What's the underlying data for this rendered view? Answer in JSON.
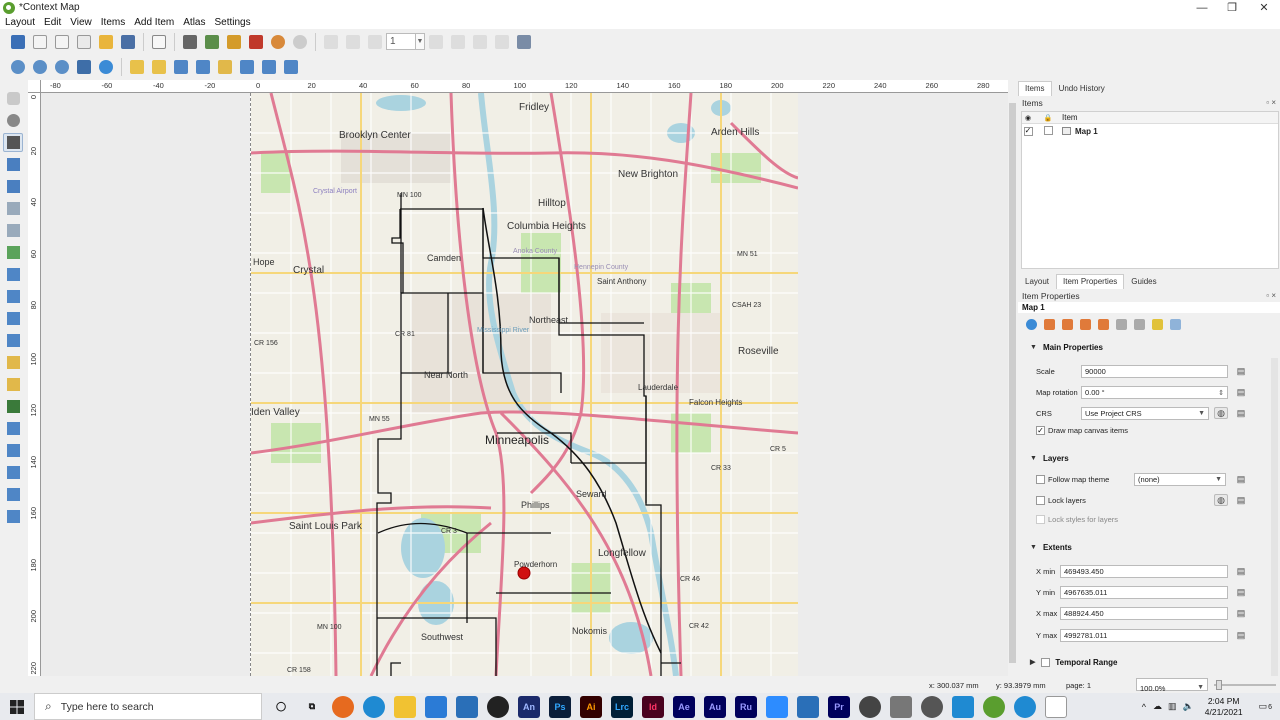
{
  "window": {
    "title": "*Context Map",
    "minimize": "—",
    "maximize": "❐",
    "close": "✕"
  },
  "menu": [
    "Layout",
    "Edit",
    "View",
    "Items",
    "Add Item",
    "Atlas",
    "Settings"
  ],
  "toolbar": {
    "page_number": "1"
  },
  "ruler": {
    "h_ticks": [
      "-80",
      "-60",
      "-40",
      "-20",
      "0",
      "20",
      "40",
      "60",
      "80",
      "100",
      "120",
      "140",
      "160",
      "180",
      "200",
      "220",
      "240",
      "260",
      "280"
    ],
    "v_ticks": [
      "0",
      "20",
      "40",
      "60",
      "80",
      "100",
      "120",
      "140",
      "160",
      "180",
      "200",
      "220"
    ]
  },
  "map": {
    "places": [
      "Fridley",
      "Brooklyn Center",
      "Arden Hills",
      "Crystal Airport",
      "MN 100",
      "New Brighton",
      "Hilltop",
      "Columbia Heights",
      "Anoka County",
      "Hennepin County",
      "Hope",
      "Crystal",
      "Camden",
      "Saint Anthony",
      "MN 51",
      "CSAH 23",
      "Northeast",
      "Mississippi River",
      "CR 81",
      "Roseville",
      "CR 156",
      "Near North",
      "Lauderdale",
      "Falcon Heights",
      "Iden Valley",
      "MN 55",
      "Minneapolis",
      "CR 5",
      "CR 33",
      "Seward",
      "Phillips",
      "Saint Louis Park",
      "CR 3",
      "Longfellow",
      "Powderhorn",
      "CR 46",
      "MN 100",
      "CR 42",
      "Nokomis",
      "Southwest",
      "CR 158"
    ]
  },
  "items_panel": {
    "tabs": [
      "Items",
      "Undo History"
    ],
    "header": "Items",
    "columns": {
      "item": "Item"
    },
    "rows": [
      {
        "name": "Map 1",
        "visible": true,
        "locked": false
      }
    ]
  },
  "props_panel": {
    "tabs": [
      "Layout",
      "Item Properties",
      "Guides"
    ],
    "header": "Item Properties",
    "item_name": "Map 1",
    "main_properties": {
      "title": "Main Properties",
      "scale_label": "Scale",
      "scale_value": "90000",
      "rotation_label": "Map rotation",
      "rotation_value": "0.00 °",
      "crs_label": "CRS",
      "crs_value": "Use Project CRS",
      "draw_canvas_label": "Draw map canvas items",
      "draw_canvas_checked": true
    },
    "layers": {
      "title": "Layers",
      "follow_theme_label": "Follow map theme",
      "theme_value": "(none)",
      "lock_layers_label": "Lock layers",
      "lock_styles_label": "Lock styles for layers"
    },
    "extents": {
      "title": "Extents",
      "xmin_label": "X min",
      "xmin_value": "469493.450",
      "ymin_label": "Y min",
      "ymin_value": "4967635.011",
      "xmax_label": "X max",
      "xmax_value": "488924.450",
      "ymax_label": "Y max",
      "ymax_value": "4992781.011"
    },
    "temporal": {
      "title": "Temporal Range"
    }
  },
  "status": {
    "x": "x: 300.037 mm",
    "y": "y: 93.3979 mm",
    "page": "page: 1",
    "zoom": "100.0%"
  },
  "taskbar": {
    "search_placeholder": "Type here to search",
    "apps": [
      "An",
      "Ps",
      "Ai",
      "Lrc",
      "Id",
      "Ae",
      "Au",
      "Ru",
      "Pr"
    ],
    "time": "2:04 PM",
    "date": "4/21/2021",
    "notification_count": "6"
  },
  "colors": {
    "accent": "#1e6fd9",
    "highway": "#e07a93",
    "boundary": "#111111",
    "water": "#aad3df",
    "park": "#c8e6b0",
    "marker": "#d01010"
  }
}
